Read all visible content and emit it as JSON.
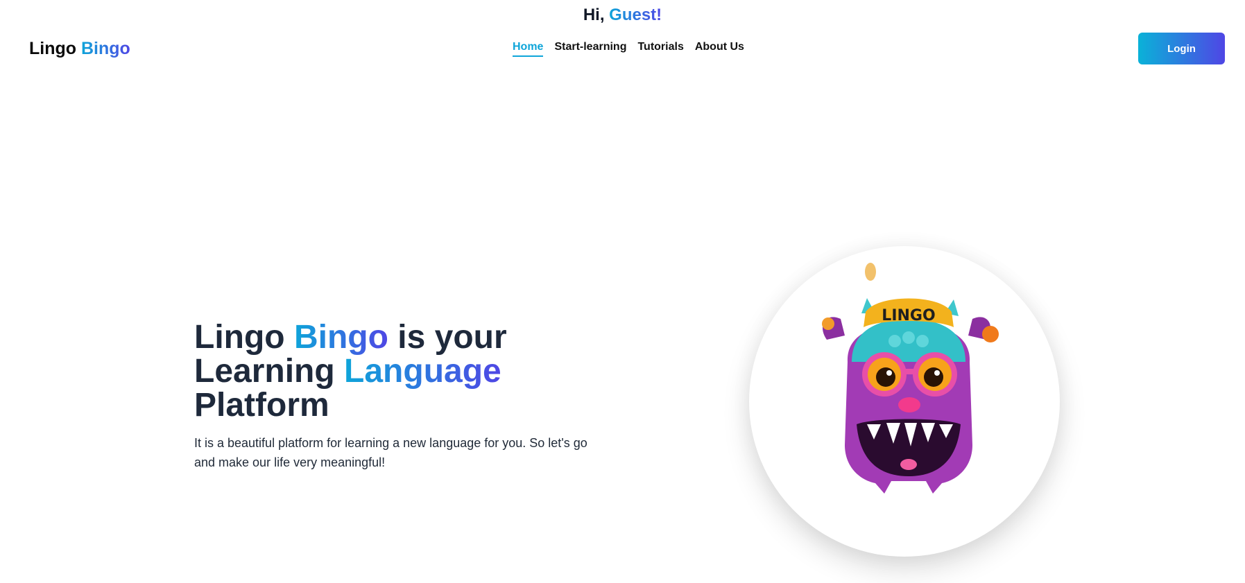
{
  "header": {
    "greeting_prefix": "Hi,",
    "greeting_name": "Guest!",
    "logo_part1": "Lingo",
    "logo_part2": "Bingo",
    "nav": [
      {
        "label": "Home",
        "active": true
      },
      {
        "label": "Start-learning",
        "active": false
      },
      {
        "label": "Tutorials",
        "active": false
      },
      {
        "label": "About Us",
        "active": false
      }
    ],
    "login_label": "Login"
  },
  "hero": {
    "title_part1": "Lingo",
    "title_part2": "Bingo",
    "title_part3": "is your",
    "title_part4": "Learning",
    "title_part5": "Language",
    "title_part6": "Platform",
    "description": "It is a beautiful platform for learning a new language for you. So let's go and make our life very meaningful!",
    "mascot_hat_text": "LINGO"
  },
  "colors": {
    "accent_start": "#0ea5d9",
    "accent_end": "#4f46e5",
    "heading": "#1e293b"
  }
}
